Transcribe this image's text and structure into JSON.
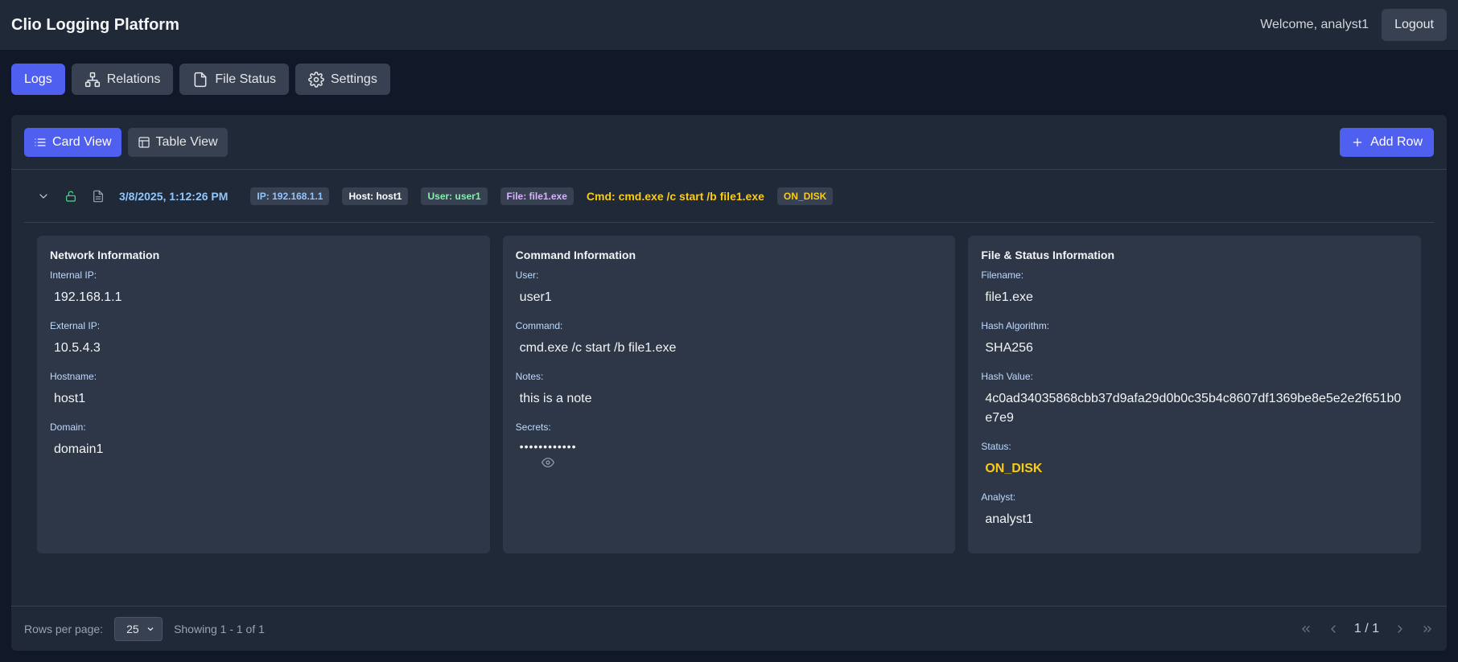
{
  "app": {
    "title": "Clio Logging Platform",
    "welcome": "Welcome, analyst1",
    "logout_label": "Logout"
  },
  "nav": {
    "logs": "Logs",
    "relations": "Relations",
    "file_status": "File Status",
    "settings": "Settings"
  },
  "toolbar": {
    "card_view": "Card View",
    "table_view": "Table View",
    "add_row": "Add Row"
  },
  "log_row": {
    "timestamp": "3/8/2025, 1:12:26 PM",
    "ip_badge": "IP: 192.168.1.1",
    "host_badge": "Host: host1",
    "user_badge": "User: user1",
    "file_badge": "File: file1.exe",
    "cmd_text": "Cmd: cmd.exe /c start /b file1.exe",
    "status_badge": "ON_DISK"
  },
  "network": {
    "title": "Network Information",
    "internal_ip_label": "Internal IP:",
    "internal_ip": "192.168.1.1",
    "external_ip_label": "External IP:",
    "external_ip": "10.5.4.3",
    "hostname_label": "Hostname:",
    "hostname": "host1",
    "domain_label": "Domain:",
    "domain": "domain1"
  },
  "command": {
    "title": "Command Information",
    "user_label": "User:",
    "user": "user1",
    "command_label": "Command:",
    "command": "cmd.exe /c start /b file1.exe",
    "notes_label": "Notes:",
    "notes": "this is a note",
    "secrets_label": "Secrets:",
    "secrets_masked": "••••••••••••"
  },
  "file_status": {
    "title": "File & Status Information",
    "filename_label": "Filename:",
    "filename": "file1.exe",
    "hash_algo_label": "Hash Algorithm:",
    "hash_algo": "SHA256",
    "hash_value_label": "Hash Value:",
    "hash_value": "4c0ad34035868cbb37d9afa29d0b0c35b4c8607df1369be8e5e2e2f651b0e7e9",
    "status_label": "Status:",
    "status": "ON_DISK",
    "analyst_label": "Analyst:",
    "analyst": "analyst1"
  },
  "footer": {
    "rows_per_page_label": "Rows per page:",
    "rows_per_page": "25",
    "showing": "Showing 1 - 1 of 1",
    "page": "1 / 1"
  },
  "colors": {
    "accent": "#4f5ff0",
    "status_yellow": "#facc15",
    "lock_green": "#4ade80"
  }
}
